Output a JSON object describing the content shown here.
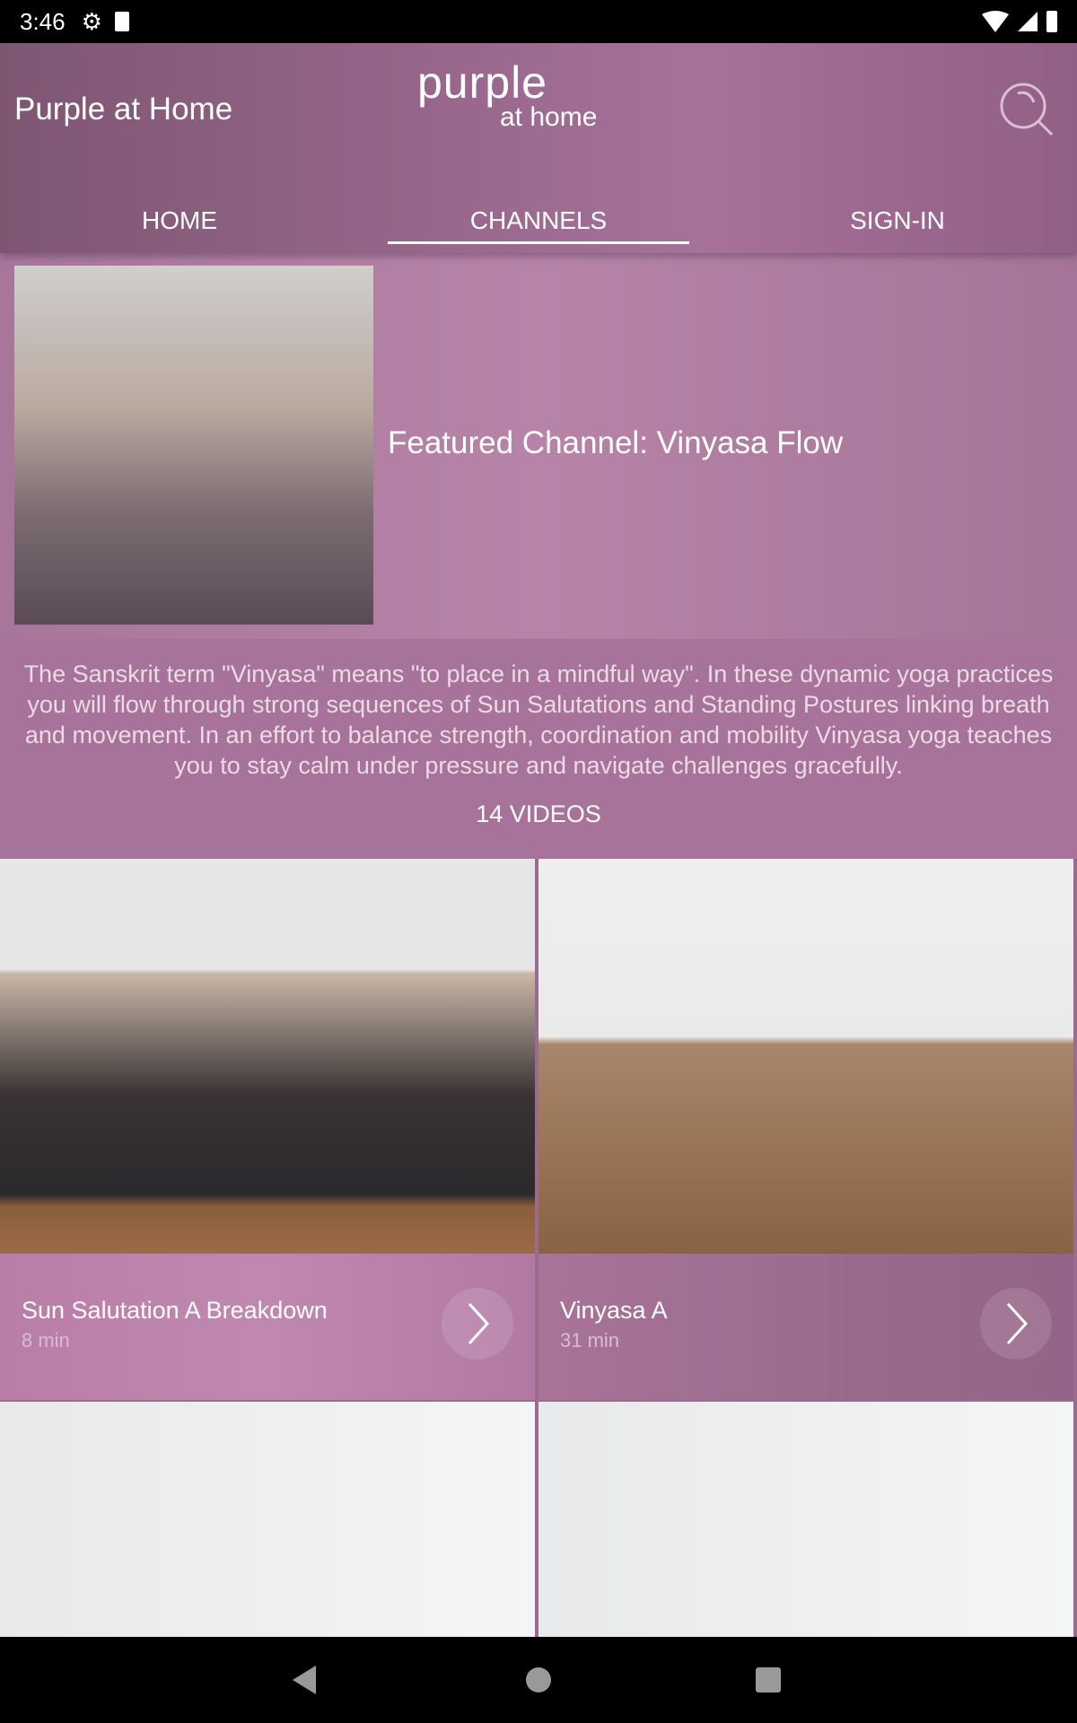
{
  "status_bar": {
    "time": "3:46",
    "icons": [
      "gear-icon",
      "sd-card-icon",
      "wifi-icon",
      "signal-icon",
      "battery-icon"
    ]
  },
  "header": {
    "title": "Purple at Home",
    "logo": {
      "main": "purple",
      "sub": "at home"
    },
    "search_icon": "search-icon"
  },
  "tabs": [
    {
      "label": "HOME",
      "active": false
    },
    {
      "label": "CHANNELS",
      "active": true
    },
    {
      "label": "SIGN-IN",
      "active": false
    }
  ],
  "featured": {
    "title": "Featured Channel: Vinyasa Flow",
    "description": "The Sanskrit term \"Vinyasa\" means \"to place in a mindful way\".  In these dynamic yoga practices you will flow through strong sequences of Sun Salutations and Standing Postures linking breath and movement.  In an effort to balance strength, coordination and mobility Vinyasa yoga teaches you to stay calm under pressure and navigate challenges gracefully.",
    "count": "14 VIDEOS"
  },
  "videos": [
    {
      "title": "Sun Salutation A Breakdown",
      "duration": "8 min"
    },
    {
      "title": "Vinyasa A",
      "duration": "31 min"
    }
  ],
  "colors": {
    "accent": "#a7739a",
    "header_dark": "#7e5672"
  }
}
